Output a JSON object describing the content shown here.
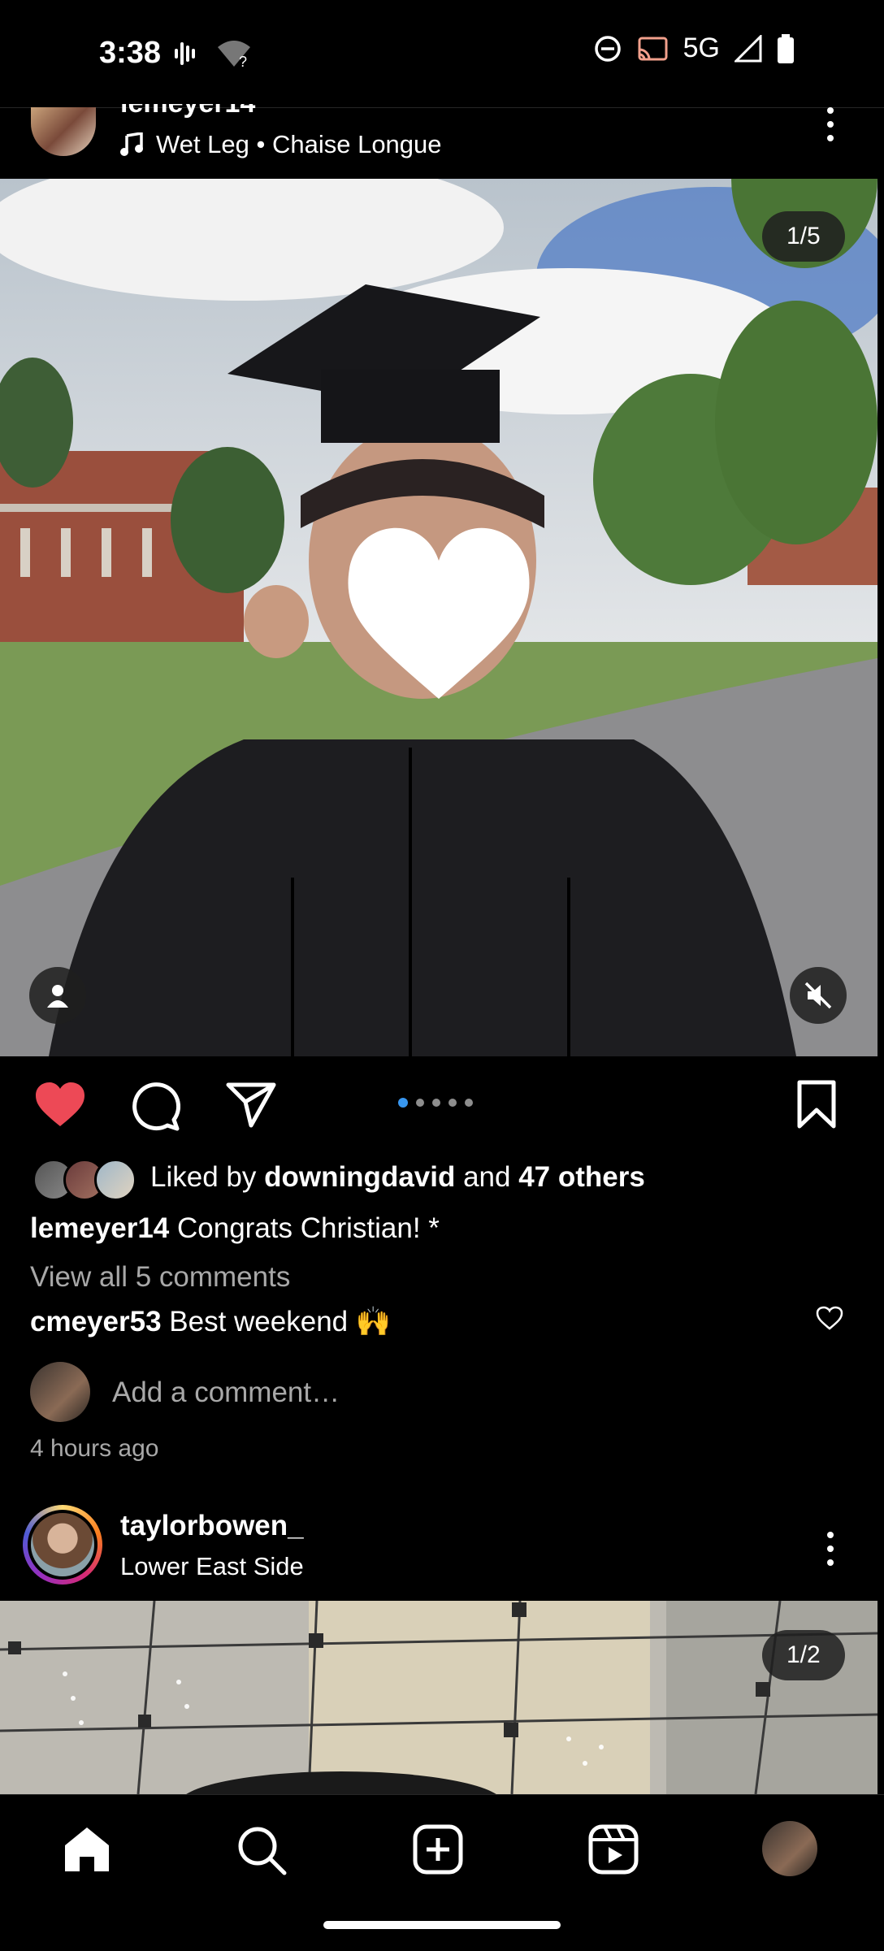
{
  "status_bar": {
    "time": "3:38",
    "network": "5G",
    "icons": [
      "voicemail-icon",
      "wifi-question-icon",
      "do-not-disturb-icon",
      "cast-icon",
      "signal-icon",
      "battery-icon"
    ]
  },
  "post1": {
    "username_partial": "lemeyer14",
    "music": "Wet Leg • Chaise Longue",
    "media_counter": "1/5",
    "carousel": {
      "count": 5,
      "active_index": 0
    },
    "liked_by_prefix": "Liked by ",
    "liked_by_user": "downingdavid",
    "liked_by_and": " and ",
    "liked_by_others": "47 others",
    "caption_user": "lemeyer14",
    "caption_text": " Congrats Christian! *",
    "view_comments": "View all 5 comments",
    "comment_user": "cmeyer53",
    "comment_text": " Best weekend 🙌",
    "add_comment_placeholder": "Add a comment…",
    "time_ago": "4 hours ago",
    "liked": true
  },
  "post2": {
    "username": "taylorbowen_",
    "location": "Lower East Side",
    "media_counter": "1/2"
  },
  "bottom_nav": {
    "items": [
      "home-icon",
      "search-icon",
      "create-icon",
      "reels-icon",
      "profile-icon"
    ]
  },
  "colors": {
    "accent_blue": "#3897f0",
    "like_red": "#ed4956",
    "background": "#000000"
  }
}
